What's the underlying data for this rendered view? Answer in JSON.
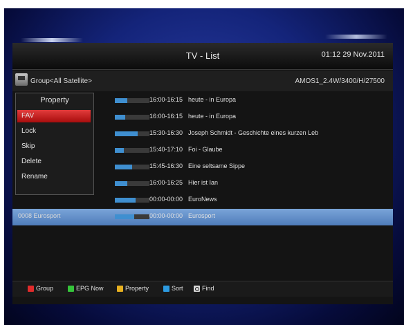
{
  "window": {
    "title": "TV - List",
    "datetime": "01:12 29 Nov.2011"
  },
  "infobar": {
    "group": "Group<All Satellite>",
    "satellite": "AMOS1_2.4W/3400/H/27500"
  },
  "property_menu": {
    "title": "Property",
    "items": [
      {
        "label": "FAV",
        "active": true
      },
      {
        "label": "Lock",
        "active": false
      },
      {
        "label": "Skip",
        "active": false
      },
      {
        "label": "Delete",
        "active": false
      },
      {
        "label": "Rename",
        "active": false
      }
    ]
  },
  "channels": [
    {
      "name": "",
      "progress": 0.35,
      "time": "16:00-16:15",
      "program": "heute - in Europa"
    },
    {
      "name": "",
      "progress": 0.3,
      "time": "16:00-16:15",
      "program": "heute - in Europa"
    },
    {
      "name": "",
      "progress": 0.65,
      "time": "15:30-16:30",
      "program": "Joseph Schmidt - Geschichte eines kurzen Leb"
    },
    {
      "name": "",
      "progress": 0.25,
      "time": "15:40-17:10",
      "program": "Foi - Glaube"
    },
    {
      "name": "",
      "progress": 0.5,
      "time": "15:45-16:30",
      "program": "Eine seltsame Sippe"
    },
    {
      "name": "",
      "progress": 0.35,
      "time": "16:00-16:25",
      "program": "Hier ist Ian"
    },
    {
      "name": "",
      "progress": 0.6,
      "time": "00:00-00:00",
      "program": "EuroNews"
    },
    {
      "name": "0008 Eurosport",
      "progress": 0.55,
      "time": "00:00-00:00",
      "program": "Eurosport",
      "selected": true
    }
  ],
  "footer": {
    "group": "Group",
    "epg": "EPG Now",
    "property": "Property",
    "sort": "Sort",
    "find": "Find"
  },
  "colors": {
    "red_key": "#e02b2b",
    "green_key": "#35c43a",
    "yellow_key": "#e6b020",
    "blue_key": "#2c9ae0",
    "progress_fill": "#3f8fd0",
    "selection": "#5a86c4"
  },
  "icons": {
    "group": "satellite-group-icon",
    "find": "find-icon"
  }
}
